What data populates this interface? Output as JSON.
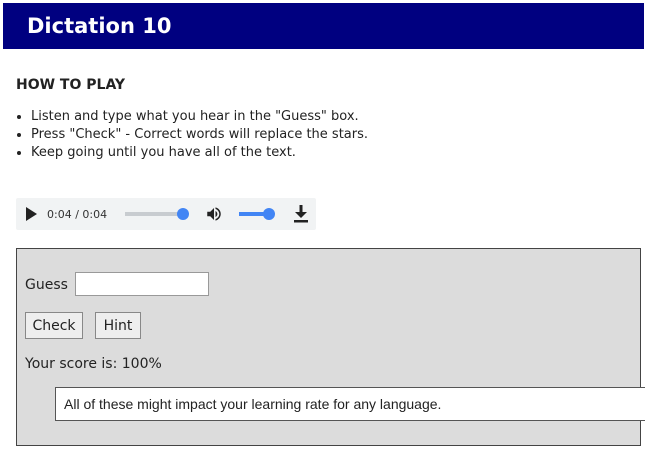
{
  "header": {
    "title": "Dictation 10"
  },
  "instructions": {
    "heading": "HOW TO PLAY",
    "items": [
      "Listen and type what you hear in the \"Guess\" box.",
      "Press \"Check\"  -  Correct words will replace the stars.",
      "Keep going until you have all of the text."
    ]
  },
  "audio": {
    "time_display": "0:04 / 0:04",
    "progress_fraction": 1.0,
    "volume_fraction": 1.0,
    "accent_color": "#4285f4",
    "icons": [
      "play-icon",
      "volume-icon",
      "download-icon"
    ]
  },
  "game": {
    "guess_label": "Guess",
    "guess_value": "",
    "check_label": "Check",
    "hint_label": "Hint",
    "score_text": "Your score is: 100%",
    "answer_text": "All of these might impact your learning rate for any language."
  },
  "colors": {
    "title_bar": "#000080",
    "game_background": "#dcdcdc"
  }
}
